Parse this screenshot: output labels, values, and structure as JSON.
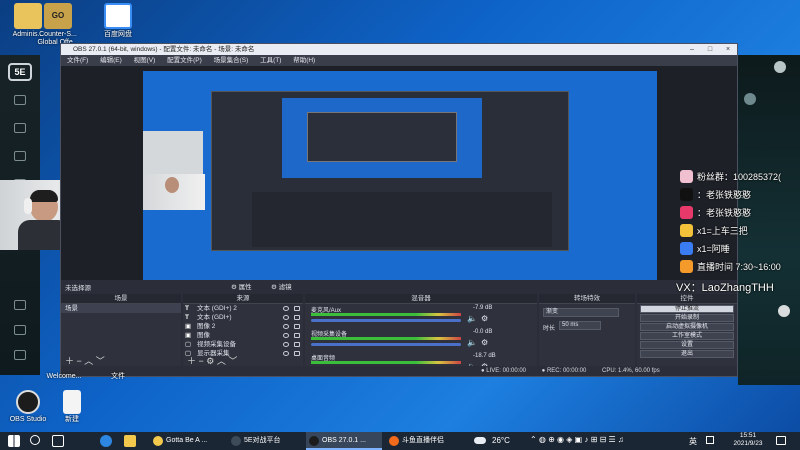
{
  "desktop": {
    "icons": [
      {
        "label": "Adminis...",
        "color": "#e9c35c"
      },
      {
        "label": "Counter-S... Global Offe...",
        "color": "#c8a24a"
      },
      {
        "label": "百度网盘",
        "color": "#3a8df5"
      }
    ],
    "bottom_icons": [
      {
        "label": "Welcome..."
      },
      {
        "label": "文件"
      }
    ],
    "bottom_icons2": [
      {
        "label": "OBS Studio"
      },
      {
        "label": "新建"
      }
    ]
  },
  "game_sidebar": {
    "logo": "5E"
  },
  "obs": {
    "title": "OBS 27.0.1 (64-bit, windows) - 配置文件: 未命名 - 场景: 未命名",
    "menu": [
      "文件(F)",
      "编辑(E)",
      "视图(V)",
      "配置文件(P)",
      "场景集合(S)",
      "工具(T)",
      "帮助(H)"
    ],
    "no_source": "未选择源",
    "tabs": {
      "props": "属性",
      "filters": "滤镜"
    },
    "docks": {
      "scenes": "场景",
      "sources": "来源",
      "mixer": "混音器",
      "transitions": "转场特效",
      "controls": "控件"
    },
    "scenes": [
      "场景"
    ],
    "sources": [
      {
        "icon": "T",
        "label": "文本 (GDI+) 2"
      },
      {
        "icon": "T",
        "label": "文本 (GDI+)"
      },
      {
        "icon": "▣",
        "label": "图像 2"
      },
      {
        "icon": "▣",
        "label": "图像"
      },
      {
        "icon": "▢",
        "label": "视频采集设备"
      },
      {
        "icon": "▢",
        "label": "显示器采集"
      }
    ],
    "mixer": [
      {
        "name": "麦克风/Aux",
        "db": "-7.9 dB"
      },
      {
        "name": "视频采集设备",
        "db": "-0.0 dB"
      },
      {
        "name": "桌面音频",
        "db": "-18.7 dB"
      }
    ],
    "transitions": {
      "type": "渐变",
      "duration_label": "时长",
      "duration_value": "50 ms"
    },
    "controls": [
      "停止推流",
      "开始录制",
      "启动虚拟摄像机",
      "工作室模式",
      "设置",
      "退出"
    ],
    "status": {
      "live": "LIVE: 00:00:00",
      "rec": "REC: 00:00:00",
      "cpu": "CPU: 1.4%, 60.00 fps"
    }
  },
  "overlay": {
    "items": [
      {
        "text": "粉丝群：100285372(",
        "color": "#f0c0d0"
      },
      {
        "text": "：老张铁憨憨",
        "color": "#111111"
      },
      {
        "text": "：老张铁憨憨",
        "color": "#e83a6a"
      },
      {
        "text": "x1=上车三把",
        "color": "#f3c23a"
      },
      {
        "text": "x1=阿睡",
        "color": "#3a7df3"
      },
      {
        "text": "直播时间 7:30~16:00",
        "color": "#f39a2a"
      }
    ],
    "vx": "VX：LaoZhangTHH"
  },
  "taskbar": {
    "apps": [
      {
        "label": "Gotta Be A ...",
        "color": "#f2c94c"
      },
      {
        "label": "5E对战平台",
        "color": "#3d4b58"
      },
      {
        "label": "OBS 27.0.1 ...",
        "color": "#1c1c1c"
      },
      {
        "label": "斗鱼直播伴侣",
        "color": "#f26b1d"
      }
    ],
    "weather": "26°C",
    "lang": "英",
    "time": "15:51",
    "date": "2021/9/23"
  }
}
